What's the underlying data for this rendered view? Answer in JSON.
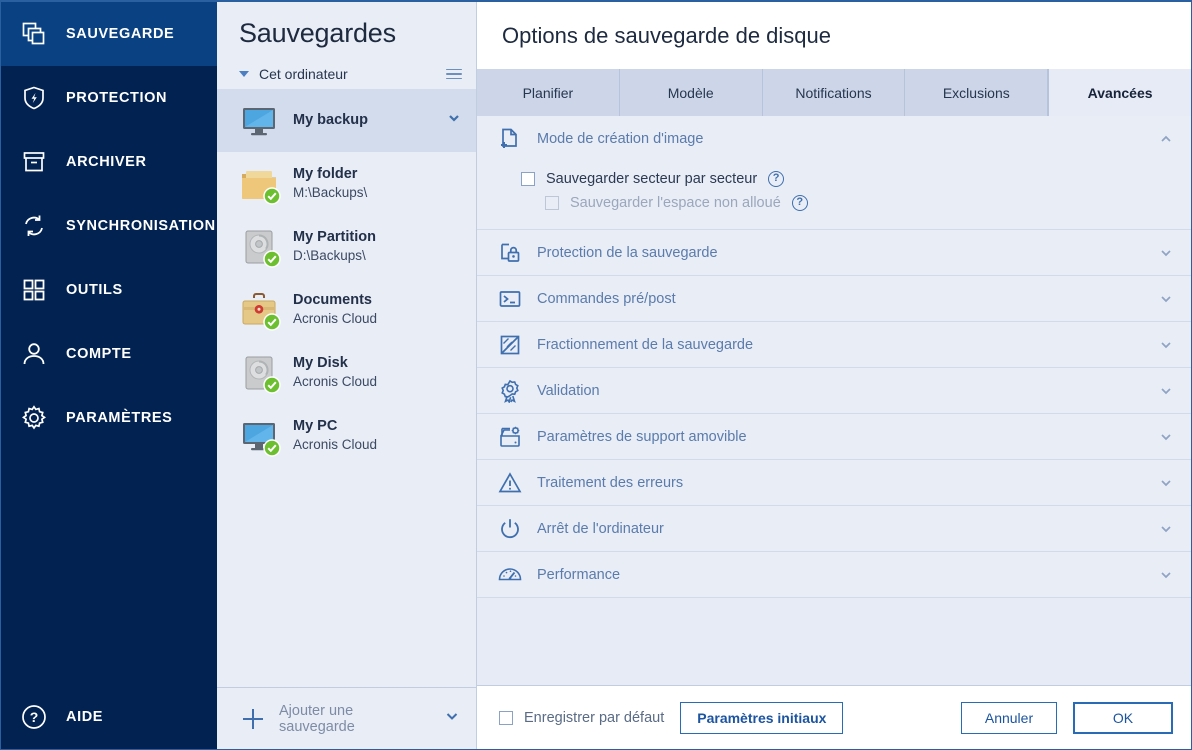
{
  "nav": {
    "items": [
      {
        "label": "SAUVEGARDE",
        "icon": "backup-icon",
        "active": true
      },
      {
        "label": "PROTECTION",
        "icon": "shield-icon",
        "active": false
      },
      {
        "label": "ARCHIVER",
        "icon": "archive-icon",
        "active": false
      },
      {
        "label": "SYNCHRONISATION",
        "icon": "sync-icon",
        "active": false
      },
      {
        "label": "OUTILS",
        "icon": "grid-icon",
        "active": false
      },
      {
        "label": "COMPTE",
        "icon": "user-icon",
        "active": false
      },
      {
        "label": "PARAMÈTRES",
        "icon": "gear-icon",
        "active": false
      }
    ],
    "help_label": "AIDE",
    "help_icon": "question-circle-icon",
    "bg_color": "#022251",
    "active_color": "#0a4182"
  },
  "list_panel": {
    "title": "Sauvegardes",
    "group_label": "Cet ordinateur",
    "menu_icon": "hamburger-icon",
    "collapse_icon": "caret-down-icon",
    "backups": [
      {
        "name": "My backup",
        "location": "",
        "icon": "monitor-icon",
        "selected": true,
        "chevron": true
      },
      {
        "name": "My folder",
        "location": "M:\\Backups\\",
        "icon": "folder-icon",
        "selected": false,
        "chevron": false
      },
      {
        "name": "My Partition",
        "location": "D:\\Backups\\",
        "icon": "hdd-icon",
        "selected": false,
        "chevron": false
      },
      {
        "name": "Documents",
        "location": "Acronis Cloud",
        "icon": "briefcase-icon",
        "selected": false,
        "chevron": false
      },
      {
        "name": "My Disk",
        "location": "Acronis Cloud",
        "icon": "hdd-icon",
        "selected": false,
        "chevron": false
      },
      {
        "name": "My PC",
        "location": "Acronis Cloud",
        "icon": "monitor-icon",
        "selected": false,
        "chevron": false
      }
    ],
    "add_label": "Ajouter une sauvegarde",
    "add_icon": "plus-icon",
    "add_chevron_icon": "chevron-down-icon"
  },
  "dialog": {
    "title": "Options de sauvegarde de disque",
    "tabs": [
      {
        "label": "Planifier",
        "active": false
      },
      {
        "label": "Modèle",
        "active": false
      },
      {
        "label": "Notifications",
        "active": false
      },
      {
        "label": "Exclusions",
        "active": false
      },
      {
        "label": "Avancées",
        "active": true
      }
    ],
    "sections": [
      {
        "label": "Mode de création d'image",
        "icon": "file-plus-icon",
        "expanded": true,
        "options": [
          {
            "label": "Sauvegarder secteur par secteur",
            "checked": false,
            "disabled": false,
            "indent": false,
            "help": "?"
          },
          {
            "label": "Sauvegarder l'espace non alloué",
            "checked": false,
            "disabled": true,
            "indent": true,
            "help": "?"
          }
        ]
      },
      {
        "label": "Protection de la sauvegarde",
        "icon": "lock-icon",
        "expanded": false,
        "options": []
      },
      {
        "label": "Commandes pré/post",
        "icon": "terminal-icon",
        "expanded": false,
        "options": []
      },
      {
        "label": "Fractionnement de la sauvegarde",
        "icon": "split-icon",
        "expanded": false,
        "options": []
      },
      {
        "label": "Validation",
        "icon": "ribbon-icon",
        "expanded": false,
        "options": []
      },
      {
        "label": "Paramètres de support amovible",
        "icon": "media-gear-icon",
        "expanded": false,
        "options": []
      },
      {
        "label": "Traitement des erreurs",
        "icon": "warning-icon",
        "expanded": false,
        "options": []
      },
      {
        "label": "Arrêt de l'ordinateur",
        "icon": "power-icon",
        "expanded": false,
        "options": []
      },
      {
        "label": "Performance",
        "icon": "gauge-icon",
        "expanded": false,
        "options": []
      }
    ],
    "footer": {
      "save_default_label": "Enregistrer par défaut",
      "save_default_checked": false,
      "reset_label": "Paramètres initiaux",
      "cancel_label": "Annuler",
      "ok_label": "OK"
    }
  }
}
